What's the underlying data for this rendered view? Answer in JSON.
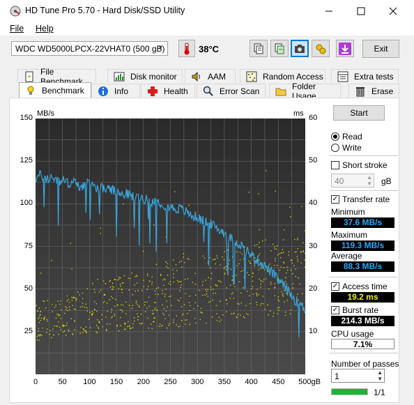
{
  "window": {
    "title": "HD Tune Pro 5.70 - Hard Disk/SSD Utility"
  },
  "menu": {
    "file": "File",
    "help": "Help"
  },
  "toolbar": {
    "drive": "WDC WD5000LPCX-22VHAT0 (500 gB)",
    "temperature": "38°C",
    "exit_label": "Exit",
    "buttons": [
      "copy-text-icon",
      "save-screenshot-icon",
      "camera-icon",
      "options-icon",
      "download-icon"
    ]
  },
  "tabs": {
    "row1": [
      {
        "label": "File Benchmark",
        "icon": "file-benchmark-icon"
      },
      {
        "label": "Disk monitor",
        "icon": "disk-monitor-icon"
      },
      {
        "label": "AAM",
        "icon": "speaker-icon"
      },
      {
        "label": "Random Access",
        "icon": "random-access-icon"
      },
      {
        "label": "Extra tests",
        "icon": "extra-tests-icon"
      }
    ],
    "row2": [
      {
        "label": "Benchmark",
        "icon": "benchmark-icon",
        "selected": true
      },
      {
        "label": "Info",
        "icon": "info-icon"
      },
      {
        "label": "Health",
        "icon": "health-icon"
      },
      {
        "label": "Error Scan",
        "icon": "error-scan-icon"
      },
      {
        "label": "Folder Usage",
        "icon": "folder-icon"
      },
      {
        "label": "Erase",
        "icon": "erase-icon"
      }
    ]
  },
  "controls": {
    "start": "Start",
    "read": "Read",
    "write": "Write",
    "short_stroke": "Short stroke",
    "short_stroke_value": "40",
    "short_stroke_unit": "gB",
    "transfer_rate": "Transfer rate",
    "minimum_label": "Minimum",
    "minimum_value": "37.6 MB/s",
    "maximum_label": "Maximum",
    "maximum_value": "119.3 MB/s",
    "average_label": "Average",
    "average_value": "88.3 MB/s",
    "access_time": "Access time",
    "access_time_value": "19.2 ms",
    "burst_rate": "Burst rate",
    "burst_rate_value": "214.3 MB/s",
    "cpu_usage_label": "CPU usage",
    "cpu_usage_value": "7.1%",
    "passes_label": "Number of passes",
    "passes_value": "1",
    "progress_text": "1/1",
    "progress_fraction": 1.0
  },
  "colors": {
    "transfer_line": "#3aa6dd",
    "access_dots": "#e6e600",
    "min_value": "#22aaff",
    "max_value": "#22aaff",
    "avg_value": "#22aaff",
    "access_value": "#f0f000",
    "burst_value": "#ffffff",
    "cpu_value": "#000000",
    "progress": "#17b53b"
  },
  "chart_data": {
    "type": "line",
    "xlabel": "",
    "ylabel": "MB/s",
    "y2label": "ms",
    "xlim": [
      0,
      500
    ],
    "ylim": [
      0,
      150
    ],
    "y2lim": [
      0,
      60
    ],
    "x_ticks": [
      "0",
      "50",
      "100",
      "150",
      "200",
      "250",
      "300",
      "350",
      "400",
      "450",
      "500gB"
    ],
    "y_ticks": [
      "25",
      "50",
      "75",
      "100",
      "125",
      "150"
    ],
    "y2_ticks": [
      "10",
      "20",
      "30",
      "40",
      "50",
      "60"
    ],
    "grid": true,
    "series": [
      {
        "axis": "left",
        "x": [
          0,
          10,
          20,
          30,
          40,
          50,
          60,
          70,
          80,
          90,
          100,
          110,
          120,
          130,
          140,
          150,
          160,
          170,
          180,
          190,
          200,
          210,
          220,
          230,
          240,
          250,
          260,
          270,
          280,
          290,
          300,
          310,
          320,
          330,
          340,
          350,
          360,
          370,
          380,
          390,
          400,
          410,
          420,
          430,
          440,
          450,
          460,
          470,
          480,
          490,
          500
        ],
        "y": [
          115,
          117,
          114,
          116,
          113,
          114,
          112,
          113,
          110,
          111,
          112,
          110,
          109,
          109,
          108,
          107,
          105,
          106,
          104,
          104,
          103,
          102,
          101,
          101,
          99,
          98,
          97,
          97,
          95,
          93,
          92,
          90,
          89,
          87,
          85,
          83,
          80,
          78,
          76,
          73,
          70,
          67,
          65,
          62,
          59,
          55,
          52,
          48,
          44,
          41,
          38
        ]
      },
      {
        "axis": "right",
        "type": "scatter",
        "x_range": [
          0,
          500
        ],
        "y_min_ms": [
          8,
          10,
          11,
          13,
          14
        ],
        "y_max_ms": [
          17,
          22,
          27,
          31,
          33
        ],
        "note_trend_ms": [
          11,
          14,
          17,
          21,
          24
        ],
        "count": 700
      }
    ]
  }
}
